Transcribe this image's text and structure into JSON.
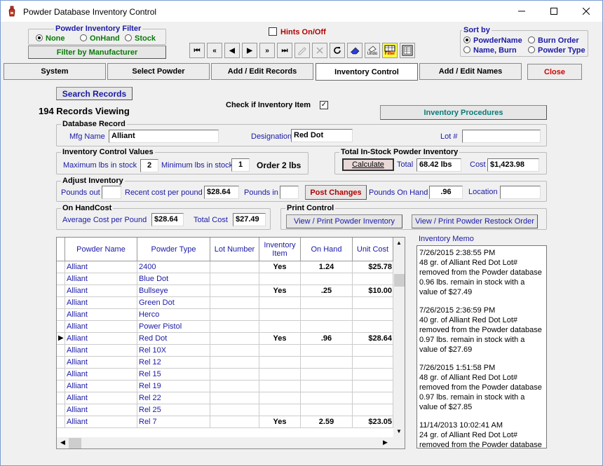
{
  "window": {
    "title": "Powder Database Inventory Control"
  },
  "filter": {
    "group_title": "Powder Inventory Filter",
    "options": [
      "None",
      "OnHand",
      "Stock"
    ],
    "selected": "None",
    "manufacturer_button": "Filter by Manufacturer"
  },
  "hints": {
    "label": "Hints On/Off",
    "checked": false
  },
  "toolbar": {
    "first": "⏮",
    "prev_page": "«",
    "prev": "◀",
    "next": "▶",
    "next_page": "»",
    "last": "⏭",
    "undo_label": "Undo",
    "filter_label": "Filter"
  },
  "sort": {
    "group_title": "Sort by",
    "options": [
      "PowderName",
      "Burn Order",
      "Name, Burn",
      "Powder Type"
    ],
    "selected": "PowderName"
  },
  "tabs": [
    "System",
    "Select Powder",
    "Add / Edit  Records",
    "Inventory Control",
    "Add / Edit Names",
    "Close"
  ],
  "active_tab": "Inventory Control",
  "search_button": "Search Records",
  "records_viewing": "194 Records Viewing",
  "inventory_item": {
    "label": "Check if Inventory Item",
    "checked": true
  },
  "procedures_button": "Inventory Procedures",
  "database_record": {
    "group_title": "Database Record",
    "mfg_label": "Mfg Name",
    "mfg_value": "Alliant",
    "designation_label": "Designation",
    "designation_value": "Red Dot",
    "lot_label": "Lot #",
    "lot_value": ""
  },
  "control_values": {
    "group_title": "Inventory Control Values",
    "max_label": "Maximum lbs in stock",
    "max_value": "2",
    "min_label": "Minimum lbs in stock",
    "min_value": "1",
    "order_text": "Order 2 lbs"
  },
  "total_instock": {
    "group_title": "Total  In-Stock Powder Inventory",
    "calculate": "Calculate",
    "total_label": "Total",
    "total_value": "68.42 lbs",
    "cost_label": "Cost",
    "cost_value": "$1,423.98"
  },
  "adjust": {
    "group_title": "Adjust Inventory",
    "pounds_out_label": "Pounds out",
    "pounds_out_value": "",
    "recent_cost_label": "Recent cost per pound",
    "recent_cost_value": "$28.64",
    "pounds_in_label": "Pounds in",
    "pounds_in_value": "",
    "post_button": "Post Changes",
    "on_hand_label": "Pounds On Hand",
    "on_hand_value": ".96",
    "location_label": "Location",
    "location_value": ""
  },
  "onhand_cost": {
    "group_title": "On HandCost",
    "avg_label": "Average Cost per Pound",
    "avg_value": "$28.64",
    "total_label": "Total Cost",
    "total_value": "$27.49"
  },
  "print_control": {
    "group_title": "Print Control",
    "inventory_button": "View / Print Powder Inventory",
    "restock_button": "View / Print Powder Restock Order"
  },
  "grid": {
    "columns": [
      "Powder Name",
      "Powder Type",
      "Lot Number",
      "Inventory Item",
      "On Hand",
      "Unit Cost"
    ],
    "current_row": 6,
    "rows": [
      [
        "Alliant",
        "2400",
        "",
        "Yes",
        "1.24",
        "$25.78"
      ],
      [
        "Alliant",
        "Blue Dot",
        "",
        "",
        "",
        ""
      ],
      [
        "Alliant",
        "Bullseye",
        "",
        "Yes",
        ".25",
        "$10.00"
      ],
      [
        "Alliant",
        "Green Dot",
        "",
        "",
        "",
        ""
      ],
      [
        "Alliant",
        "Herco",
        "",
        "",
        "",
        ""
      ],
      [
        "Alliant",
        "Power Pistol",
        "",
        "",
        "",
        ""
      ],
      [
        "Alliant",
        "Red Dot",
        "",
        "Yes",
        ".96",
        "$28.64"
      ],
      [
        "Alliant",
        "Rel 10X",
        "",
        "",
        "",
        ""
      ],
      [
        "Alliant",
        "Rel 12",
        "",
        "",
        "",
        ""
      ],
      [
        "Alliant",
        "Rel 15",
        "",
        "",
        "",
        ""
      ],
      [
        "Alliant",
        "Rel 19",
        "",
        "",
        "",
        ""
      ],
      [
        "Alliant",
        "Rel 22",
        "",
        "",
        "",
        ""
      ],
      [
        "Alliant",
        "Rel 25",
        "",
        "",
        "",
        ""
      ],
      [
        "Alliant",
        "Rel 7",
        "",
        "Yes",
        "2.59",
        "$23.05"
      ]
    ]
  },
  "memo": {
    "label": "Inventory Memo",
    "entries": [
      "7/26/2015 2:38:55 PM\n 48 gr. of Alliant Red Dot Lot#\nremoved from the Powder database\n 0.96 lbs. remain in stock with a\nvalue of $27.49",
      "7/26/2015 2:36:59 PM\n 40 gr. of Alliant Red Dot Lot#\nremoved from the Powder database\n 0.97 lbs. remain in stock with a\nvalue of $27.69",
      "7/26/2015 1:51:58 PM\n 48 gr. of Alliant Red Dot Lot#\nremoved from the Powder database\n 0.97 lbs. remain in stock with a\nvalue of $27.85",
      "11/14/2013 10:02:41 AM\n 24 gr. of Alliant Red Dot Lot#\nremoved from the Powder database"
    ]
  },
  "colors": {
    "label_blue": "#1a1aa6",
    "group_green": "#0a7a0a",
    "close_red": "#d00000"
  }
}
